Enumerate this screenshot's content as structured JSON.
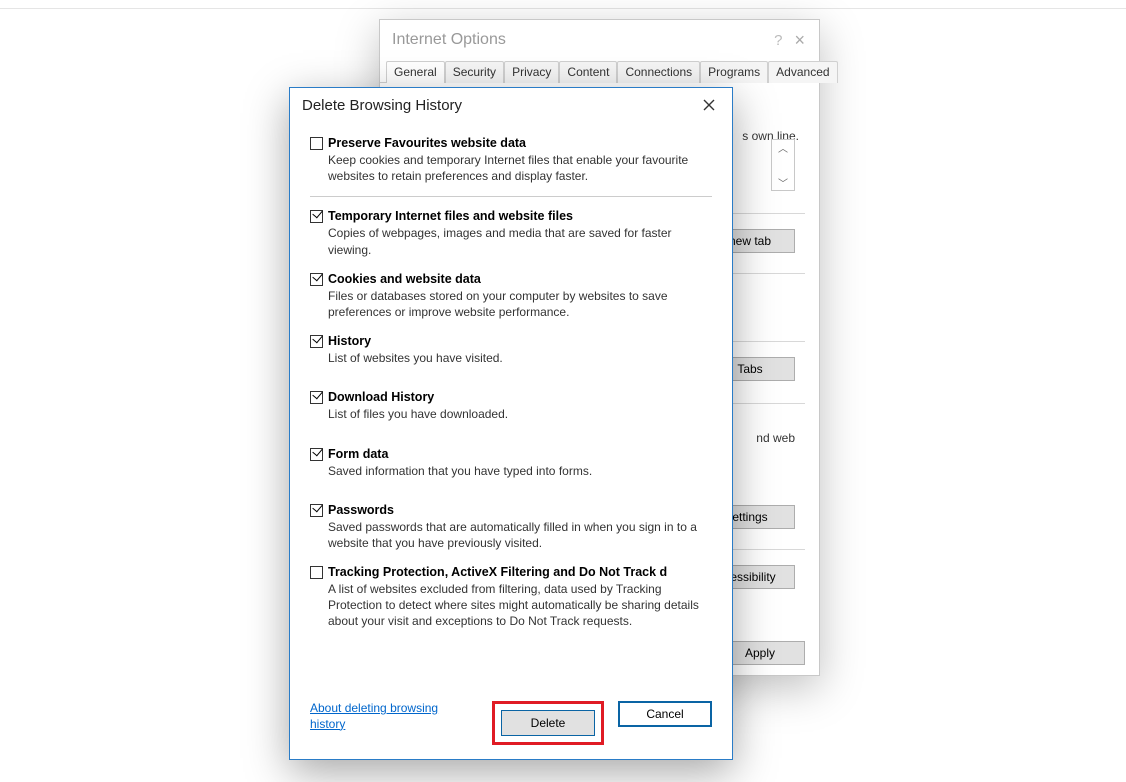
{
  "background_window": {
    "title": "Internet Options",
    "help_icon": "?",
    "close_icon": "×",
    "tabs": [
      "General",
      "Security",
      "Privacy",
      "Content",
      "Connections",
      "Programs",
      "Advanced"
    ],
    "active_tab": "General",
    "fragment_text_1": "s own line.",
    "fragment_text_2": "new tab",
    "fragment_text_3": "Tabs",
    "fragment_text_4": "nd web",
    "fragment_text_5": "ettings",
    "fragment_text_6": "cessibility",
    "apply_label": "Apply"
  },
  "dialog": {
    "title": "Delete Browsing History",
    "close_icon": "×",
    "options": [
      {
        "key": "preserve",
        "checked": false,
        "label": "Preserve Favourites website data",
        "desc": "Keep cookies and temporary Internet files that enable your favourite websites to retain preferences and display faster."
      },
      {
        "key": "tempfiles",
        "checked": true,
        "label": "Temporary Internet files and website files",
        "desc": "Copies of webpages, images and media that are saved for faster viewing."
      },
      {
        "key": "cookies",
        "checked": true,
        "label": "Cookies and website data",
        "desc": "Files or databases stored on your computer by websites to save preferences or improve website performance."
      },
      {
        "key": "history",
        "checked": true,
        "label": "History",
        "desc": "List of websites you have visited."
      },
      {
        "key": "download",
        "checked": true,
        "label": "Download History",
        "desc": "List of files you have downloaded."
      },
      {
        "key": "formdata",
        "checked": true,
        "label": "Form data",
        "desc": "Saved information that you have typed into forms."
      },
      {
        "key": "passwords",
        "checked": true,
        "label": "Passwords",
        "desc": "Saved passwords that are automatically filled in when you sign in to a website that you have previously visited."
      },
      {
        "key": "tracking",
        "checked": false,
        "label": "Tracking Protection, ActiveX Filtering and Do Not Track d",
        "desc": "A list of websites excluded from filtering, data used by Tracking Protection to detect where sites might automatically be sharing details about your visit and exceptions to Do Not Track requests."
      }
    ],
    "link_text": "About deleting browsing history",
    "delete_label": "Delete",
    "cancel_label": "Cancel"
  }
}
